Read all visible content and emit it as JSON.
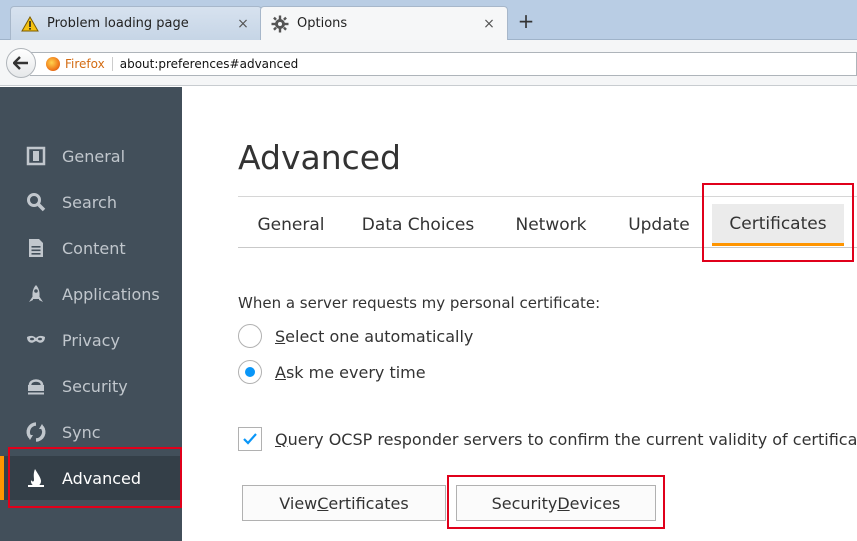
{
  "tabs": [
    {
      "label": "Problem loading page",
      "icon": "warning-icon",
      "active": false
    },
    {
      "label": "Options",
      "icon": "gear-icon",
      "active": true
    }
  ],
  "tab_close": "×",
  "new_tab": "+",
  "navbar": {
    "identity_label": "Firefox",
    "url": "about:preferences#advanced"
  },
  "sidebar": {
    "items": [
      {
        "label": "General",
        "icon": "general-icon"
      },
      {
        "label": "Search",
        "icon": "search-icon"
      },
      {
        "label": "Content",
        "icon": "content-icon"
      },
      {
        "label": "Applications",
        "icon": "applications-icon"
      },
      {
        "label": "Privacy",
        "icon": "privacy-mask-icon"
      },
      {
        "label": "Security",
        "icon": "security-icon"
      },
      {
        "label": "Sync",
        "icon": "sync-icon"
      },
      {
        "label": "Advanced",
        "icon": "advanced-icon",
        "selected": true
      }
    ]
  },
  "main": {
    "heading": "Advanced",
    "subtabs": [
      "General",
      "Data Choices",
      "Network",
      "Update",
      "Certificates"
    ],
    "selected_subtab": "Certificates",
    "cert_request_label": "When a server requests my personal certificate:",
    "radio_options": [
      {
        "accesskey": "S",
        "rest": "elect one automatically",
        "checked": false
      },
      {
        "accesskey": "A",
        "rest": "sk me every time",
        "checked": true
      }
    ],
    "ocsp": {
      "accesskey": "Q",
      "rest": "uery OCSP responder servers to confirm the current validity of certificates",
      "checked": true
    },
    "buttons": {
      "view_certificates": {
        "pre": "View ",
        "accesskey": "C",
        "post": "ertificates"
      },
      "security_devices": {
        "pre": "Security ",
        "accesskey": "D",
        "post": "evices"
      }
    }
  },
  "colors": {
    "accent": "#ff9500",
    "sidebar_bg": "#424f5a",
    "radio_checked": "#0996f8",
    "annotation": "#e0001b"
  }
}
